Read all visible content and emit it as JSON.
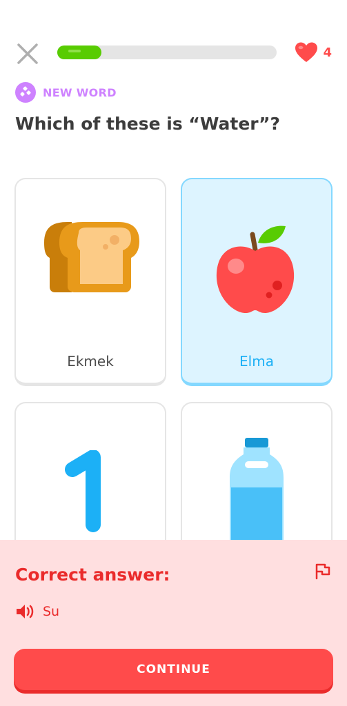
{
  "header": {
    "close_icon": "close-icon",
    "progress_fraction": 0.2,
    "hearts_count": "4"
  },
  "tag": {
    "label": "NEW WORD",
    "icon": "sparkle-icon"
  },
  "question": "Which of these is “Water”?",
  "choices": [
    {
      "label": "Ekmek",
      "icon": "bread-icon",
      "selected": false
    },
    {
      "label": "Elma",
      "icon": "apple-icon",
      "selected": true
    },
    {
      "label": "",
      "icon": "number-one-icon",
      "selected": false
    },
    {
      "label": "",
      "icon": "water-bottle-icon",
      "selected": false
    }
  ],
  "feedback": {
    "title": "Correct answer:",
    "answer": "Su",
    "continue_label": "CONTINUE",
    "colors": {
      "title": "#ea2b2b",
      "background": "#ffdfe0",
      "button": "#ff4b4b"
    }
  },
  "colors": {
    "progress": "#58cc02",
    "accent": "#ce82ff",
    "selected": "#1cb0f6"
  }
}
